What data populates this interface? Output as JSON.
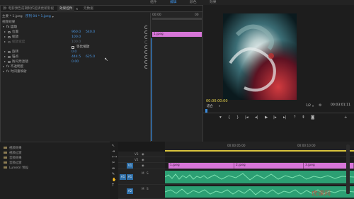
{
  "topbar": {
    "items": [
      "组件",
      "编辑",
      "颜色",
      "效果"
    ],
    "active_index": 1
  },
  "effect_controls": {
    "tabs": [
      "源: 电影预告前期制作超清更新影视",
      "效果控件",
      "元数据"
    ],
    "active_tab": 1,
    "sequence_label": "主要 * 1.jpeg",
    "sequence_link": "序列 04 * 1.jpeg",
    "section_header": "视频效果",
    "motion_label": "fx 运动",
    "props": [
      {
        "name": "位置",
        "values": [
          "960.0",
          "540.0"
        ]
      },
      {
        "name": "缩放",
        "values": [
          "100.0"
        ]
      },
      {
        "name": "缩放宽度",
        "values": [
          "100.0"
        ],
        "disabled": true
      },
      {
        "name": "等比缩放",
        "checkbox": true,
        "checked": true
      },
      {
        "name": "旋转",
        "values": [
          "0.0"
        ]
      },
      {
        "name": "锚点",
        "values": [
          "444.5",
          "625.0"
        ]
      },
      {
        "name": "防闪烁滤镜",
        "values": [
          "0.00"
        ]
      }
    ],
    "opacity_label": "fx 不透明度",
    "time_remap_label": "fx 时间重映射",
    "timeline_header": "00:00",
    "timeline_clip": "1.jpeg",
    "timecode": "00:00:00:00"
  },
  "monitor": {
    "timecode_left": "00:00:00:00",
    "fit_label": "适合",
    "resolution_label": "1/2",
    "timecode_right": "00:03:01:11",
    "colors": {
      "timecode": "#e8d44d"
    }
  },
  "project_bin": {
    "items": [
      "视频效果",
      "视频过渡",
      "音频效果",
      "音频过渡",
      "Lumetri 预设"
    ]
  },
  "timeline": {
    "ruler_labels": [
      "00:00:05:00",
      "00:00:10:00"
    ],
    "tracks": [
      {
        "id": "V3",
        "kind": "video"
      },
      {
        "id": "V2",
        "kind": "video"
      },
      {
        "id": "V1",
        "kind": "video",
        "targeted": true
      },
      {
        "id": "A1",
        "kind": "audio",
        "targeted": true
      },
      {
        "id": "A2",
        "kind": "audio"
      },
      {
        "id": "A3",
        "kind": "audio"
      }
    ],
    "v1_clips": [
      "1.jpeg",
      "2.jpeg",
      "3.jpeg"
    ],
    "colors": {
      "video_clip": "#d776d8",
      "audio_clip": "#2c9f73",
      "track_target": "#2f6fa8"
    }
  },
  "watermark": "虎课网"
}
